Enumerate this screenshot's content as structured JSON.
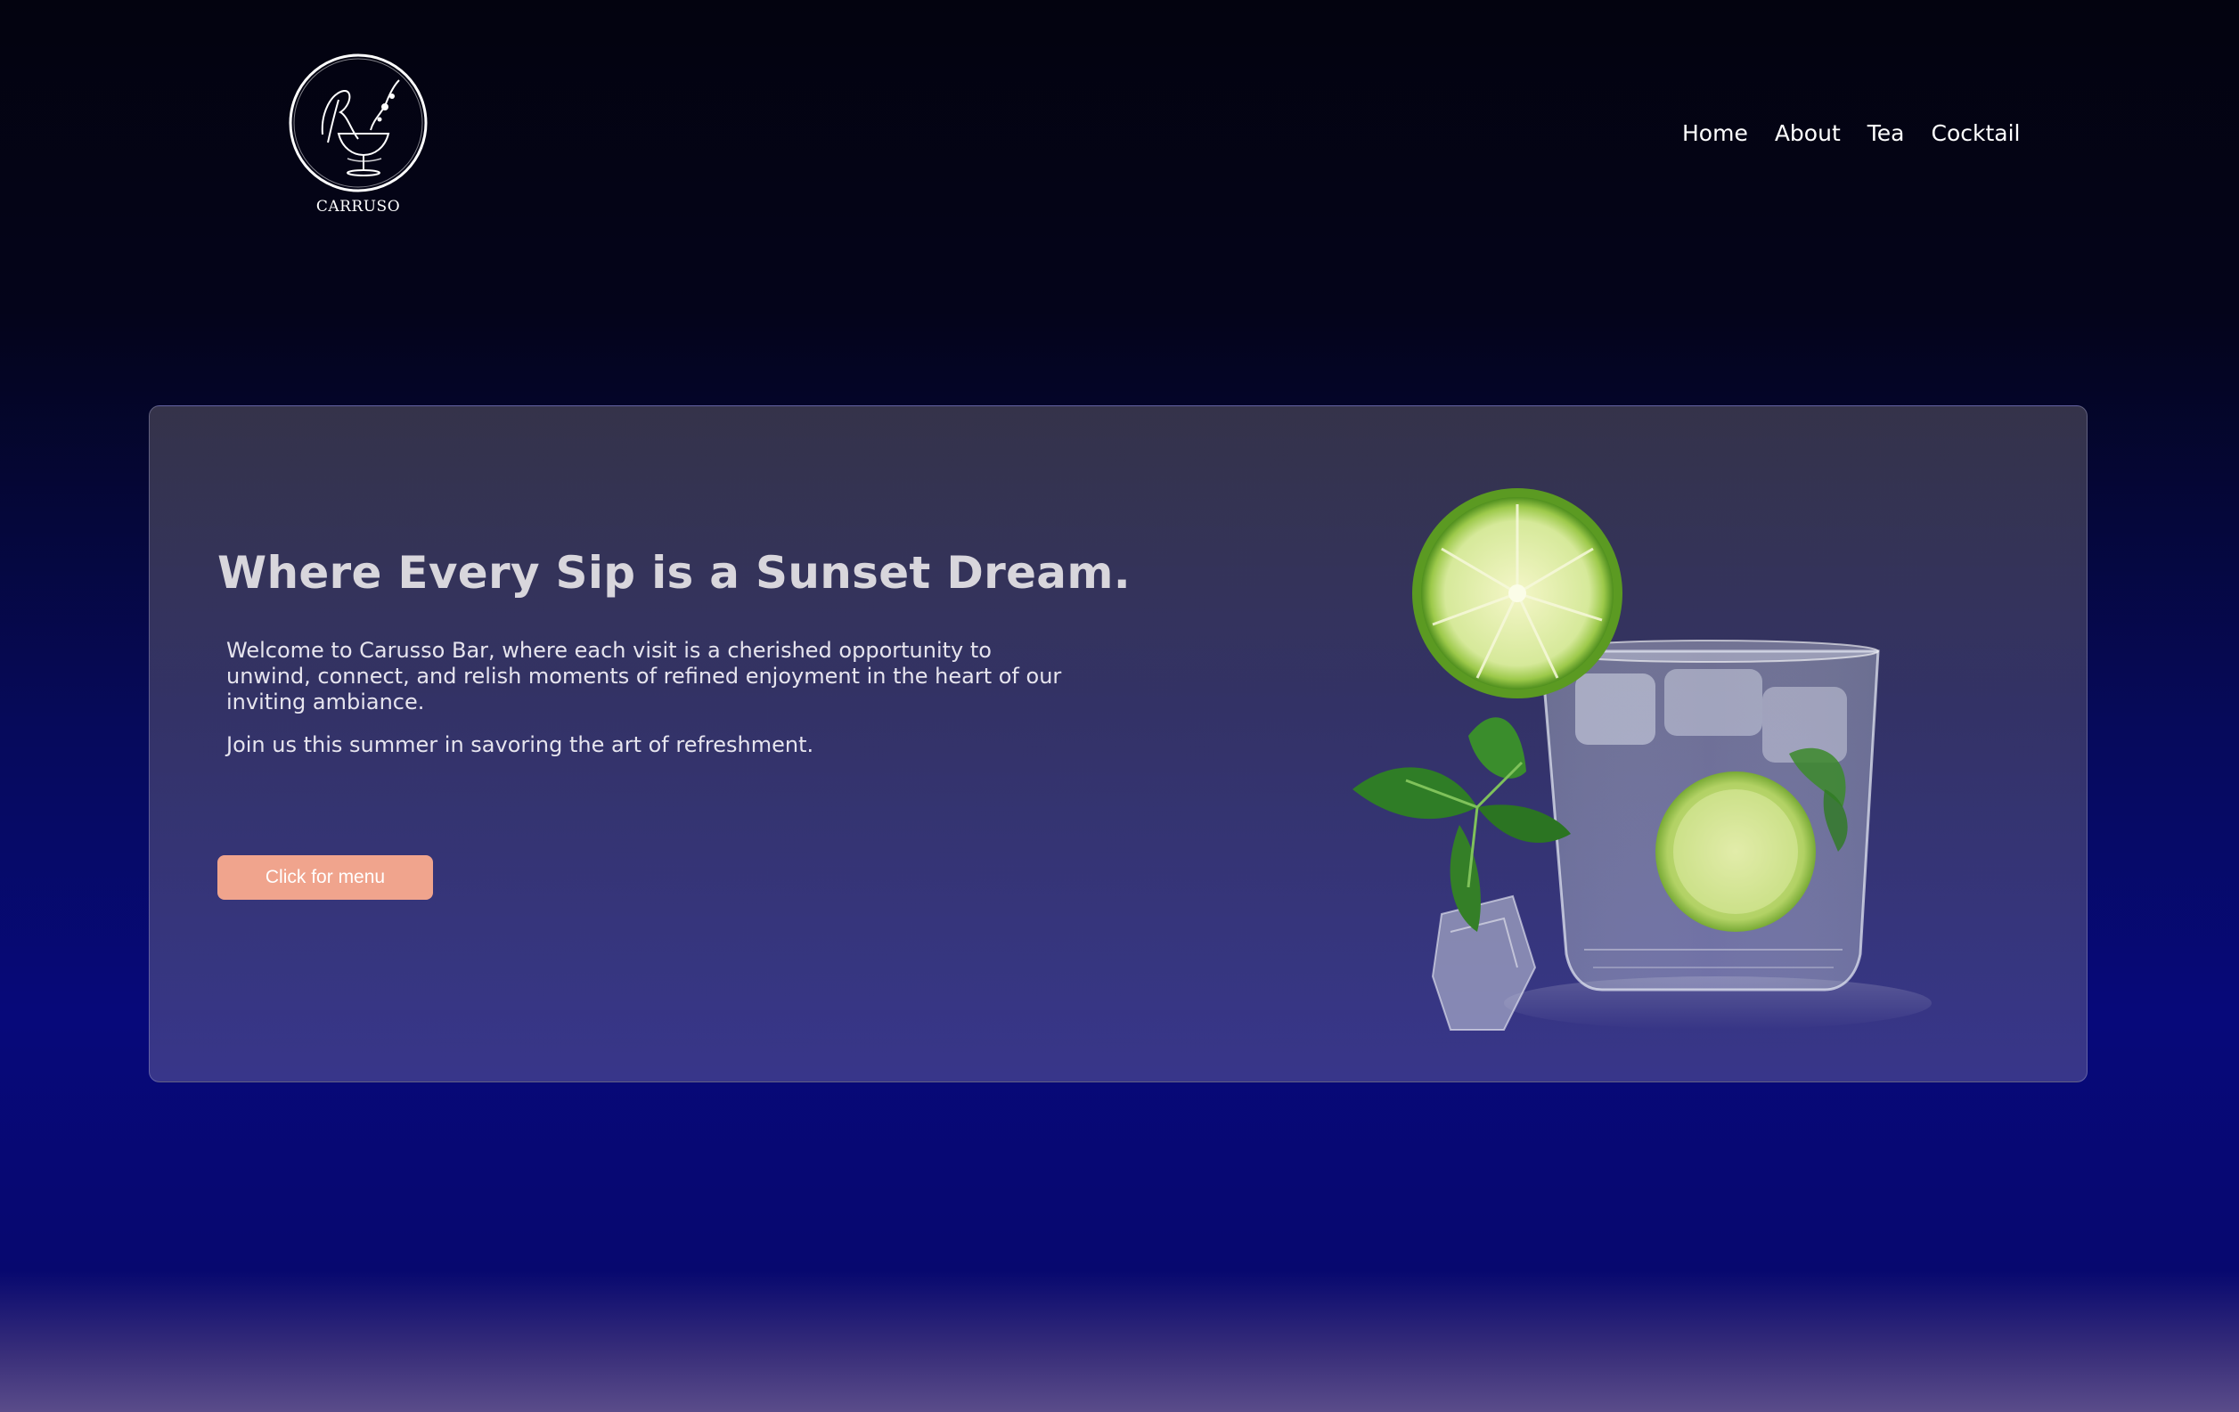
{
  "brand": {
    "logo_icon": "cocktail-glass-logo",
    "name": "CARRUSO"
  },
  "nav": {
    "items": [
      {
        "label": "Home"
      },
      {
        "label": "About"
      },
      {
        "label": "Tea"
      },
      {
        "label": "Cocktail"
      }
    ]
  },
  "hero": {
    "headline": "Where Every Sip is a Sunset Dream.",
    "paragraph_1": "Welcome to Carusso Bar, where each visit is a cherished opportunity to unwind, connect, and relish moments of refined enjoyment in the heart of our inviting ambiance.",
    "paragraph_2": "Join us this summer in savoring the art of refreshment.",
    "cta_label": "Click for menu",
    "image_icon": "mojito-glass-image"
  },
  "colors": {
    "background_top": "#03030f",
    "background_bottom": "#07097a",
    "button": "#f0a48d",
    "headline": "#d8d6dc"
  }
}
